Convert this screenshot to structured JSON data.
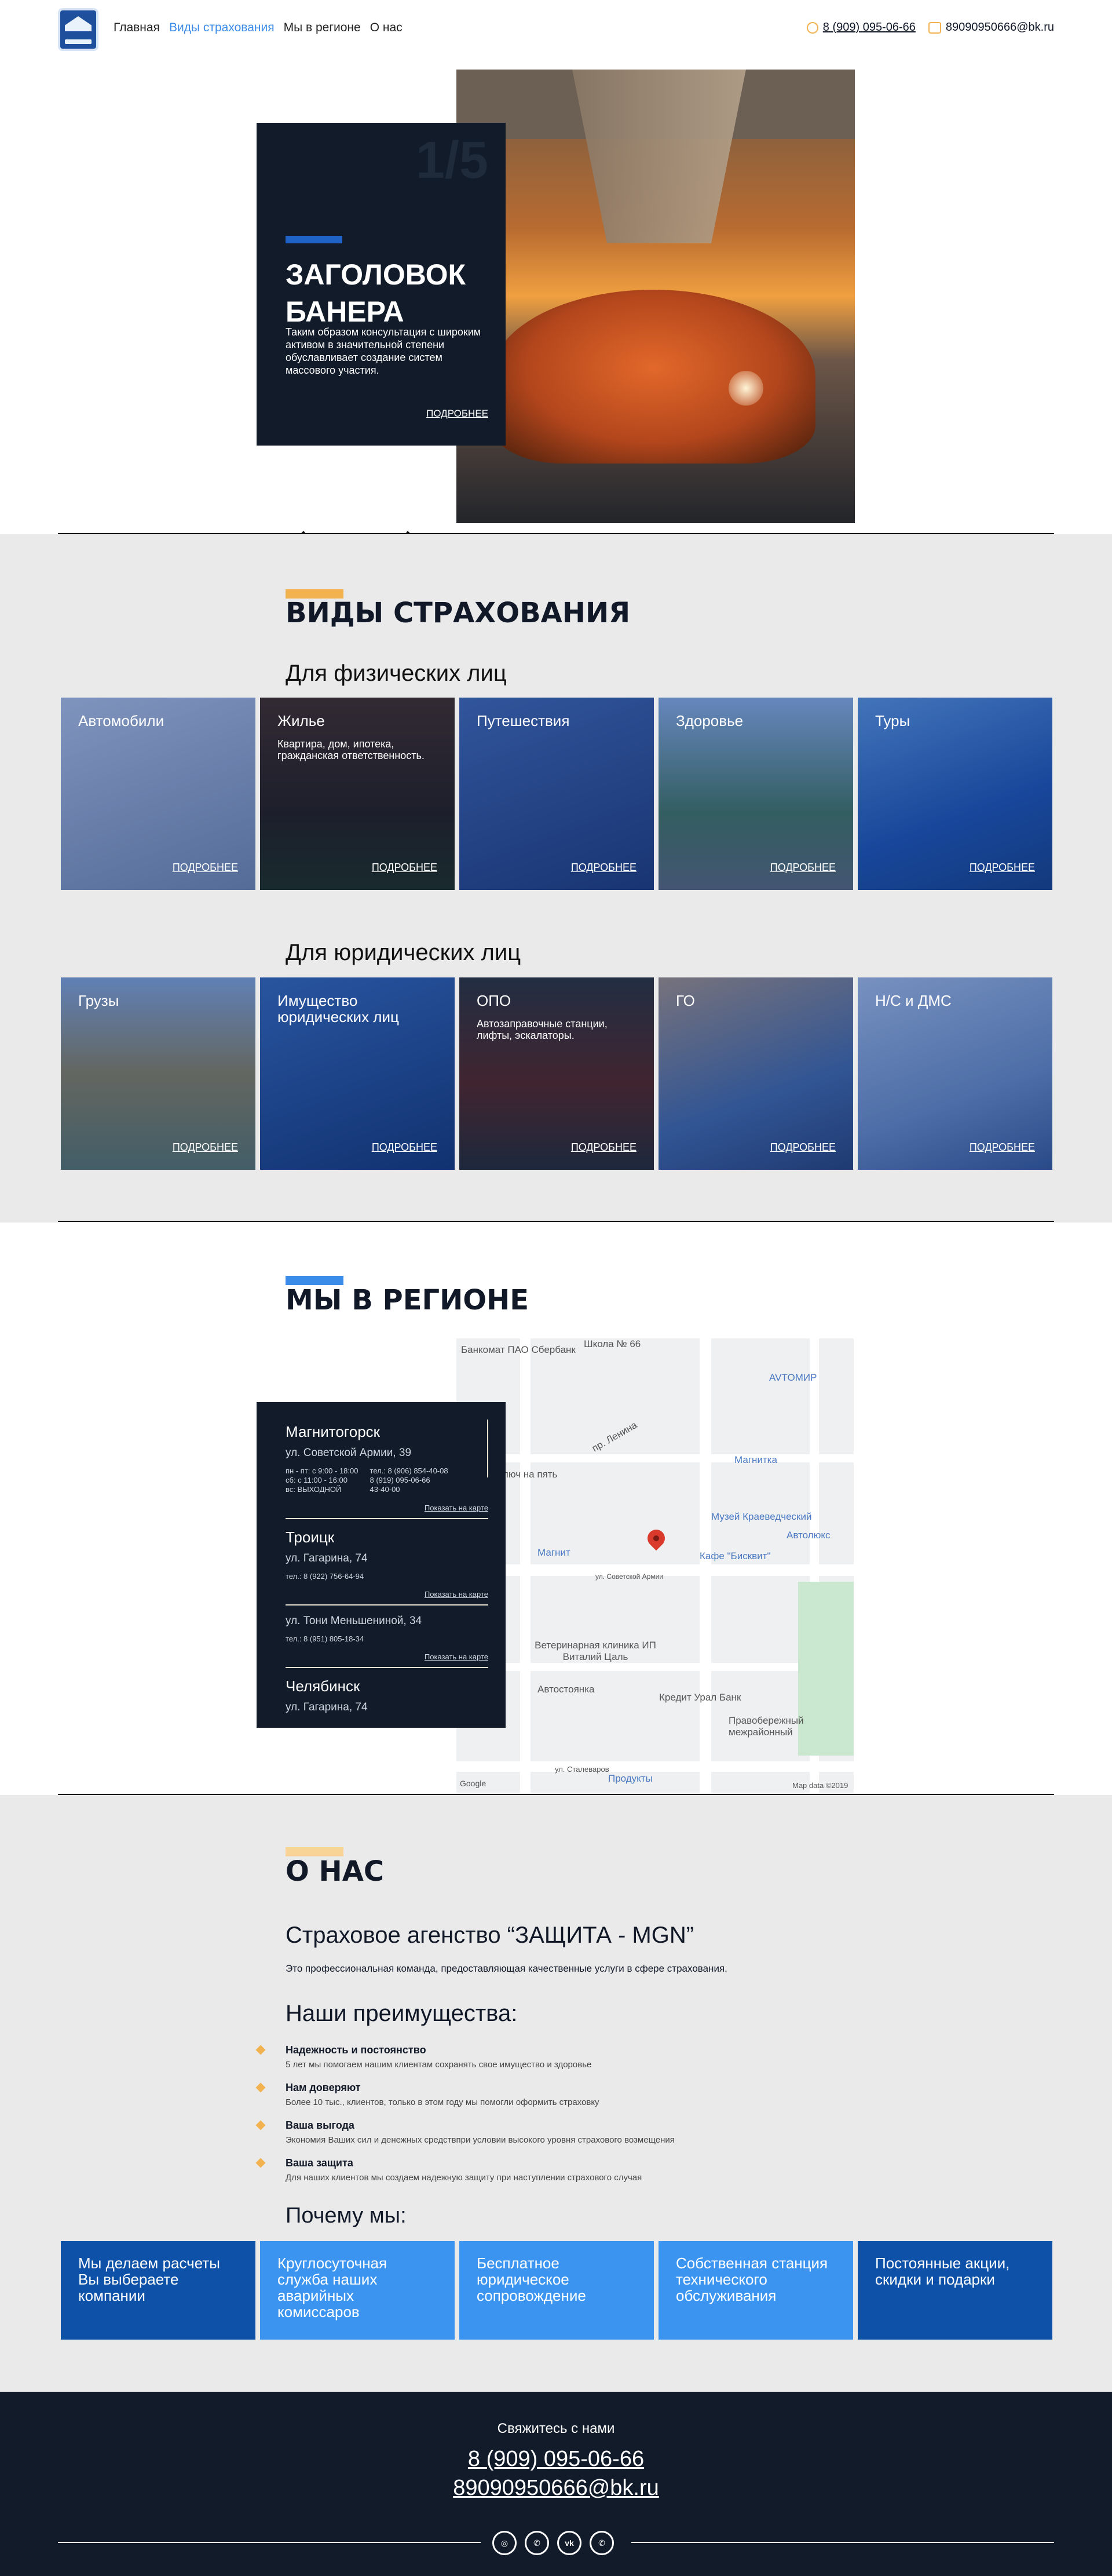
{
  "header": {
    "nav": [
      "Главная",
      "Виды страхования",
      "Мы в регионе",
      "О нас"
    ],
    "phone": "8 (909) 095-06-66",
    "email": "89090950666@bk.ru"
  },
  "hero": {
    "counter": "1/5",
    "title": "Заголовок банера",
    "text": "Таким образом консультация с широким активом в значительной степени обуславливает создание систем массового участия.",
    "more": "ПОДРОБНЕЕ"
  },
  "insurance": {
    "title": "Виды страхования",
    "individuals_title": "Для физических лиц",
    "individuals": [
      {
        "name": "Автомобили",
        "desc": "",
        "more": "ПОДРОБНЕЕ"
      },
      {
        "name": "Жилье",
        "desc": "Квартира, дом, ипотека, гражданская ответственность.",
        "more": "ПОДРОБНЕЕ"
      },
      {
        "name": "Путешествия",
        "desc": "",
        "more": "ПОДРОБНЕЕ"
      },
      {
        "name": "Здоровье",
        "desc": "",
        "more": "ПОДРОБНЕЕ"
      },
      {
        "name": "Туры",
        "desc": "",
        "more": "ПОДРОБНЕЕ"
      }
    ],
    "legal_title": "Для юридических лиц",
    "legal": [
      {
        "name": "Грузы",
        "desc": "",
        "more": "ПОДРОБНЕЕ"
      },
      {
        "name": "Имущество юридических лиц",
        "desc": "",
        "more": "ПОДРОБНЕЕ"
      },
      {
        "name": "ОПО",
        "desc": "Автозаправочные станции, лифты, эскалаторы.",
        "more": "ПОДРОБНЕЕ"
      },
      {
        "name": "ГО",
        "desc": "",
        "more": "ПОДРОБНЕЕ"
      },
      {
        "name": "Н/С и ДМС",
        "desc": "",
        "more": "ПОДРОБНЕЕ"
      }
    ]
  },
  "region": {
    "title": "Мы в регионе",
    "map_labels": [
      "Банкомат ПАО Сбербанк",
      "Школа № 66",
      "AVTOМИР",
      "пр. Ленина",
      "Магнитка",
      "Ключ на пять",
      "Музей Краеведческий",
      "Автолюкс",
      "Магнит",
      "Кафе \"Бисквит\"",
      "ул. Советской Армии",
      "Ветеринарная клиника ИП Виталий Цаль",
      "Автостоянка",
      "Кредит Урал Банк",
      "Правобережный межрайонный",
      "ул. Сталеваров",
      "Продукты",
      "Map data ©2019",
      "Google"
    ],
    "offices": [
      {
        "city": "Магнитогорск",
        "address": "ул. Советской Армии, 39",
        "hours": "пн - пт: с 9:00 - 18:00\nсб: с 11:00 - 16:00\nвс: ВЫХОДНОЙ",
        "phones": "тел.: 8 (906) 854-40-08\n8 (919) 095-06-66\n43-40-00",
        "showmap": "Показать на карте"
      },
      {
        "city": "Троицк",
        "address": "ул. Гагарина, 74",
        "phones": "тел.: 8 (922) 756-64-94",
        "showmap": "Показать на карте"
      },
      {
        "city": "",
        "address": "ул. Тони Меньшениной, 34",
        "phones": "тел.: 8 (951) 805-18-34",
        "showmap": "Показать на карте"
      },
      {
        "city": "Челябинск",
        "address": "ул. Гагарина, 74",
        "phones": "",
        "showmap": ""
      }
    ]
  },
  "about": {
    "title": "О нас",
    "agency": "Страховое агенство “ЗАЩИТА - MGN”",
    "lead": "Это профессиональная команда, предоставляющая качественные услуги в сфере страхования.",
    "adv_title": "Наши преимущества:",
    "advantages": [
      {
        "title": "Надежность и постоянство",
        "desc": "5 лет мы помогаем нашим клиентам сохранять свое имущество и здоровье"
      },
      {
        "title": "Нам доверяют",
        "desc": "Более 10 тыс., клиентов, только в этом году мы помогли оформить страховку"
      },
      {
        "title": "Ваша выгода",
        "desc": "Экономия Ваших сил и денежных средствпри условии высокого уровня страхового возмещения"
      },
      {
        "title": "Ваша защита",
        "desc": "Для наших клиентов мы создаем надежную защиту при наступлении страхового случая"
      }
    ],
    "why_title": "Почему мы:",
    "why": [
      "Мы делаем расчеты Вы выбераете компании",
      "Круглосуточная служба наших аварийных комиссаров",
      "Бесплатное юридическое сопровождение",
      "Собственная станция технического обслуживания",
      "Постоянные акции, скидки и подарки"
    ]
  },
  "footer": {
    "cta": "Свяжитесь с нами",
    "phone": "8 (909) 095-06-66",
    "email": "89090950666@bk.ru",
    "social": [
      "instagram-icon",
      "viber-icon",
      "vk-icon",
      "whatsapp-icon"
    ]
  },
  "colors": {
    "dark": "#111b2a",
    "blue": "#1f63c7",
    "light_blue": "#3b8be8",
    "yellow": "#f2b24f",
    "gray": "#eaeaea"
  }
}
